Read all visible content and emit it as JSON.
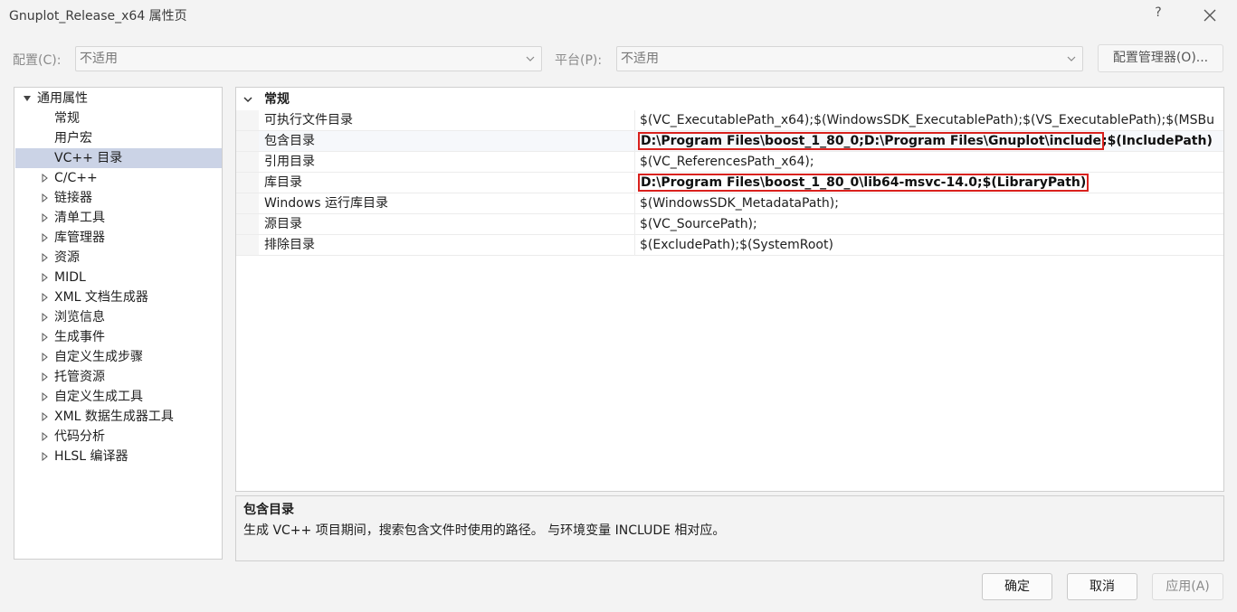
{
  "window": {
    "title": "Gnuplot_Release_x64 属性页",
    "help": "?"
  },
  "header": {
    "config_label": "配置(C):",
    "config_value": "不适用",
    "platform_label": "平台(P):",
    "platform_value": "不适用",
    "config_manager": "配置管理器(O)..."
  },
  "tree": {
    "root": "通用属性",
    "children": [
      "常规",
      "用户宏",
      "VC++ 目录"
    ],
    "selected": "VC++ 目录",
    "groups": [
      "C/C++",
      "链接器",
      "清单工具",
      "库管理器",
      "资源",
      "MIDL",
      "XML 文档生成器",
      "浏览信息",
      "生成事件",
      "自定义生成步骤",
      "托管资源",
      "自定义生成工具",
      "XML 数据生成器工具",
      "代码分析",
      "HLSL 编译器"
    ]
  },
  "grid": {
    "category": "常规",
    "rows": [
      {
        "name": "可执行文件目录",
        "value": "$(VC_ExecutablePath_x64);$(WindowsSDK_ExecutablePath);$(VS_ExecutablePath);$(MSBu"
      },
      {
        "name": "包含目录",
        "value_highlighted": "D:\\Program Files\\boost_1_80_0;D:\\Program Files\\Gnuplot\\include",
        "value_rest": ";$(IncludePath)"
      },
      {
        "name": "引用目录",
        "value": "$(VC_ReferencesPath_x64);"
      },
      {
        "name": "库目录",
        "value_highlighted": "D:\\Program Files\\boost_1_80_0\\lib64-msvc-14.0;$(LibraryPath)"
      },
      {
        "name": "Windows 运行库目录",
        "value": "$(WindowsSDK_MetadataPath);"
      },
      {
        "name": "源目录",
        "value": "$(VC_SourcePath);"
      },
      {
        "name": "排除目录",
        "value": "$(ExcludePath);$(SystemRoot)"
      }
    ]
  },
  "description": {
    "title": "包含目录",
    "text": "生成 VC++ 项目期间，搜索包含文件时使用的路径。 与环境变量 INCLUDE 相对应。"
  },
  "footer": {
    "ok": "确定",
    "cancel": "取消",
    "apply": "应用(A)"
  },
  "colors": {
    "highlight_border": "#d9211d",
    "selection": "#cbd3e6"
  }
}
